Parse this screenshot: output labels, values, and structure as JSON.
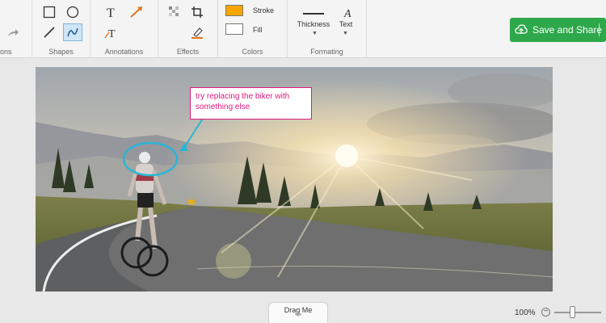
{
  "toolbar": {
    "groups": {
      "partial": "ons",
      "shapes": "Shapes",
      "annotations": "Annotations",
      "effects": "Effects",
      "colors": "Colors",
      "formating": "Formating"
    },
    "colors": {
      "stroke_label": "Stroke",
      "fill_label": "Fill",
      "stroke_value": "#f7a600",
      "fill_value": "#ffffff"
    },
    "formating": {
      "thickness_label": "Thickness",
      "text_label": "Text"
    },
    "save_button": "Save and Share",
    "accent": "#2ea84a"
  },
  "canvas": {
    "annotation_text": "try replacing the biker with something else",
    "annotation_color": "#e0197d",
    "marker_color": "#29b6d6"
  },
  "footer": {
    "drag_label": "Drag Me",
    "zoom_level": "100%",
    "zoom_fraction": 0.33
  }
}
